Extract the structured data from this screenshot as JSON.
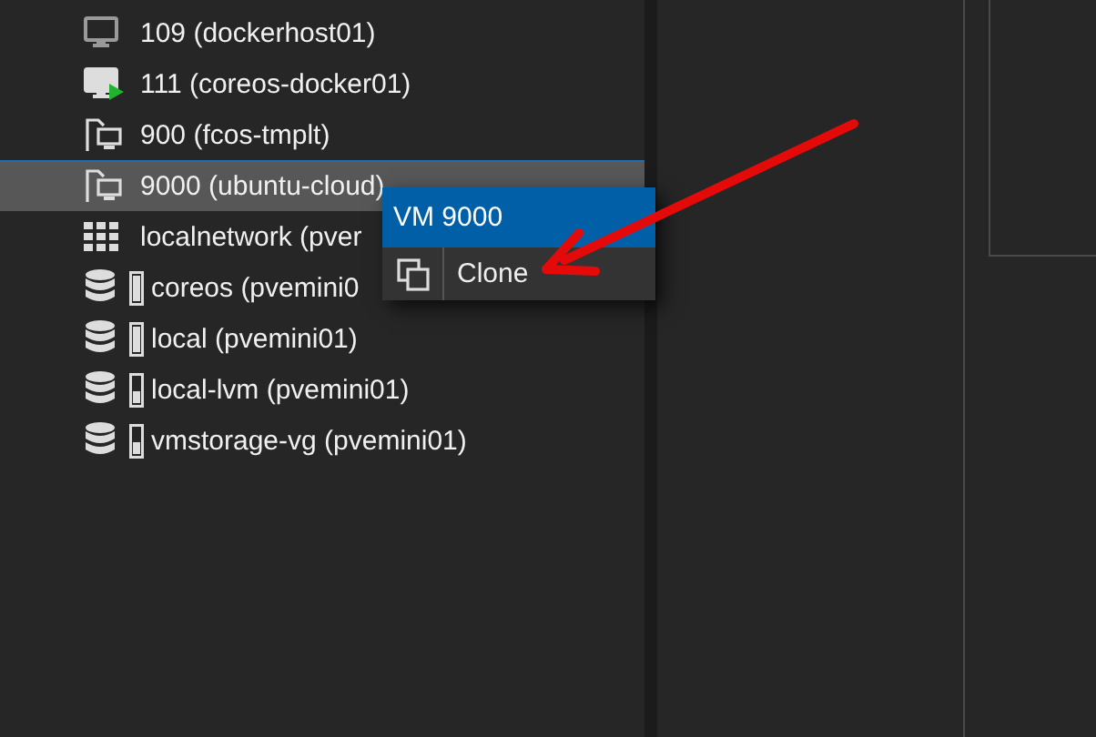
{
  "tree": {
    "items": [
      {
        "kind": "vm",
        "label": "109 (dockerhost01)",
        "running": false,
        "selected": false
      },
      {
        "kind": "vm",
        "label": "111 (coreos-docker01)",
        "running": true,
        "selected": false
      },
      {
        "kind": "template",
        "label": "900 (fcos-tmplt)",
        "selected": false
      },
      {
        "kind": "template",
        "label": "9000 (ubuntu-cloud)",
        "selected": true
      },
      {
        "kind": "network",
        "label": "localnetwork (pver",
        "selected": false
      },
      {
        "kind": "storage",
        "label": "coreos (pvemini0",
        "full": true,
        "selected": false
      },
      {
        "kind": "storage",
        "label": "local (pvemini01)",
        "full": true,
        "selected": false
      },
      {
        "kind": "storage",
        "label": "local-lvm (pvemini01)",
        "full": false,
        "selected": false
      },
      {
        "kind": "storage",
        "label": "vmstorage-vg (pvemini01)",
        "full": false,
        "selected": false
      }
    ]
  },
  "context_menu": {
    "title": "VM 9000",
    "items": [
      {
        "label": "Clone",
        "selected": false
      }
    ]
  }
}
